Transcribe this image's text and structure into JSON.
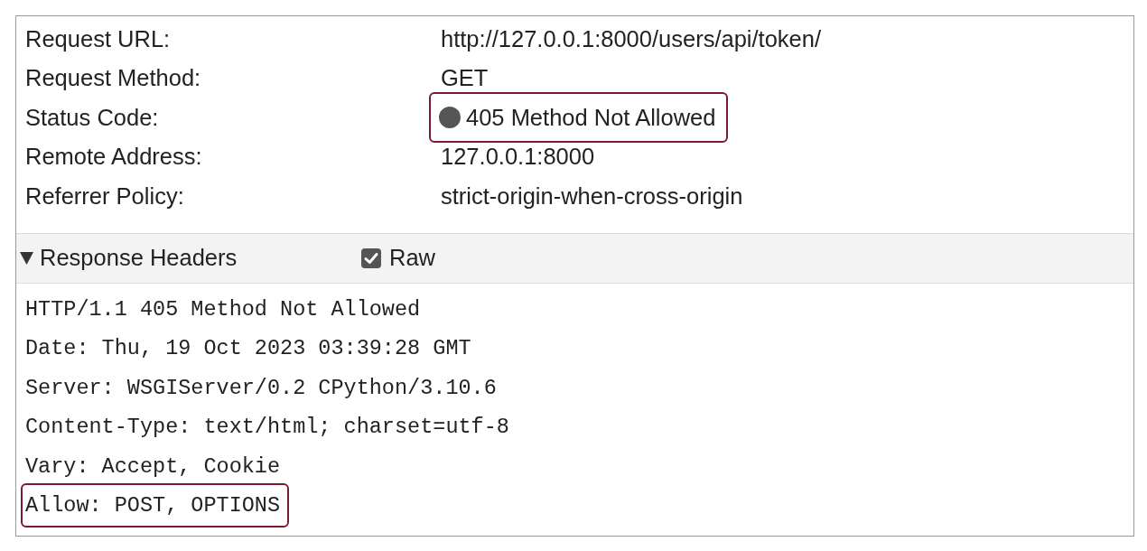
{
  "general": {
    "rows": [
      {
        "label": "Request URL:",
        "value": "http://127.0.0.1:8000/users/api/token/",
        "kind": "text",
        "highlighted": false
      },
      {
        "label": "Request Method:",
        "value": "GET",
        "kind": "text",
        "highlighted": false
      },
      {
        "label": "Status Code:",
        "value": "405 Method Not Allowed",
        "kind": "status",
        "highlighted": true
      },
      {
        "label": "Remote Address:",
        "value": "127.0.0.1:8000",
        "kind": "text",
        "highlighted": false
      },
      {
        "label": "Referrer Policy:",
        "value": "strict-origin-when-cross-origin",
        "kind": "text",
        "highlighted": false
      }
    ]
  },
  "response_headers": {
    "title": "Response Headers",
    "expanded": true,
    "raw": {
      "label": "Raw",
      "checked": true
    },
    "lines": [
      {
        "text": "HTTP/1.1 405 Method Not Allowed",
        "highlighted": false
      },
      {
        "text": "Date: Thu, 19 Oct 2023 03:39:28 GMT",
        "highlighted": false
      },
      {
        "text": "Server: WSGIServer/0.2 CPython/3.10.6",
        "highlighted": false
      },
      {
        "text": "Content-Type: text/html; charset=utf-8",
        "highlighted": false
      },
      {
        "text": "Vary: Accept, Cookie",
        "highlighted": false
      },
      {
        "text": "Allow: POST, OPTIONS",
        "highlighted": true
      }
    ]
  }
}
